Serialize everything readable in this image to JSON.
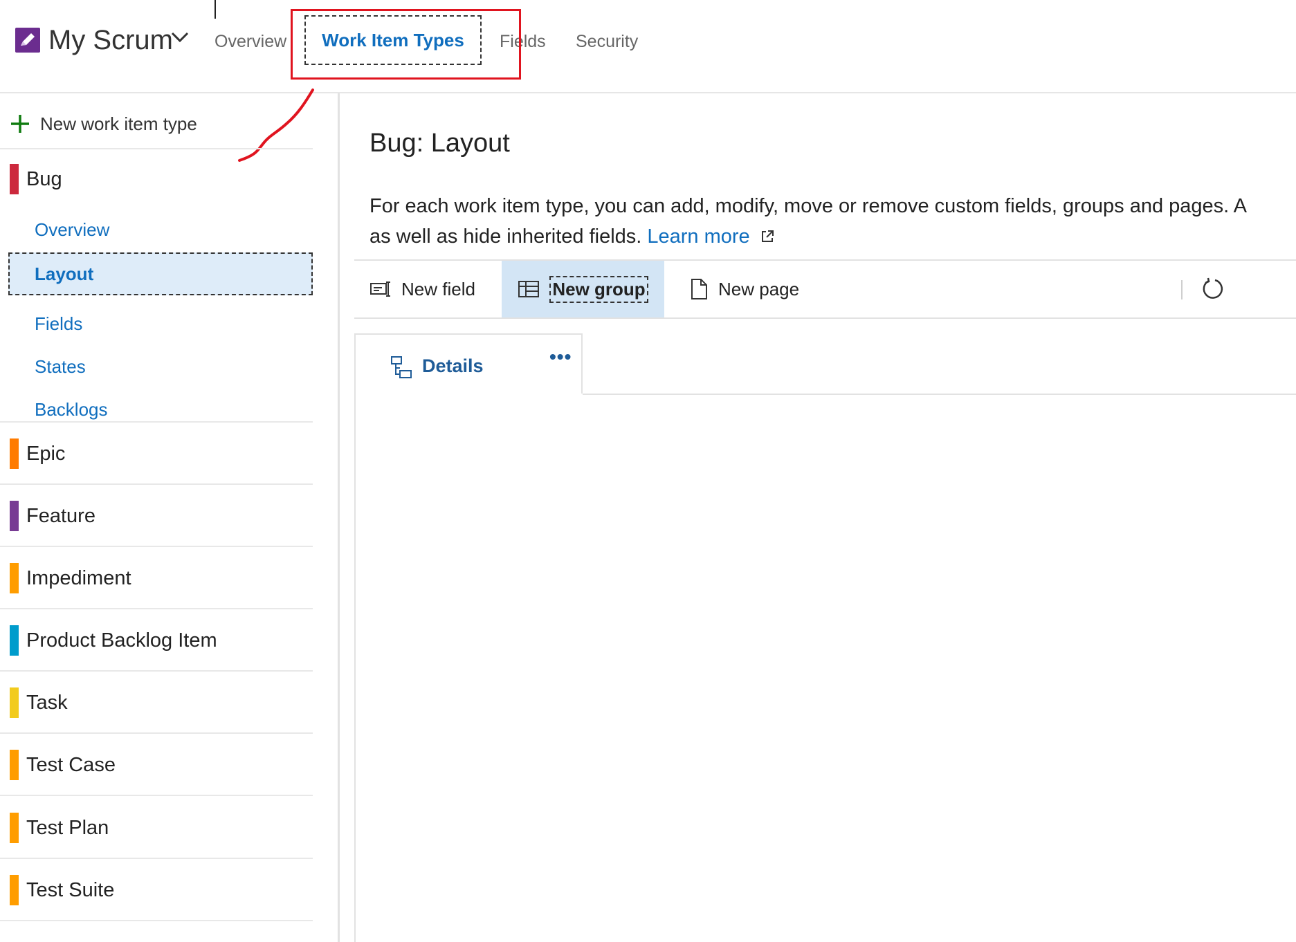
{
  "header": {
    "app_name": "My Scrum",
    "tabs": [
      "Overview",
      "Work Item Types",
      "Fields",
      "Security"
    ],
    "active_tab": "Work Item Types"
  },
  "sidebar": {
    "new_button": "New work item type",
    "selected_type": {
      "name": "Bug",
      "color": "#cc293d"
    },
    "subnav": [
      "Overview",
      "Layout",
      "Fields",
      "States",
      "Backlogs"
    ],
    "active_subnav": "Layout",
    "types": [
      {
        "name": "Epic",
        "color": "#ff7b00"
      },
      {
        "name": "Feature",
        "color": "#773b93"
      },
      {
        "name": "Impediment",
        "color": "#ff9d00"
      },
      {
        "name": "Product Backlog Item",
        "color": "#009ccc"
      },
      {
        "name": "Task",
        "color": "#f2cb1d"
      },
      {
        "name": "Test Case",
        "color": "#ff9d00"
      },
      {
        "name": "Test Plan",
        "color": "#ff9d00"
      },
      {
        "name": "Test Suite",
        "color": "#ff9d00"
      }
    ]
  },
  "main": {
    "title": "Bug: Layout",
    "description_line1": "For each work item type, you can add, modify, move or remove custom fields, groups and pages. A",
    "description_line2": "as well as hide inherited fields.",
    "learn_more": "Learn more",
    "toolbar": {
      "new_field": "New field",
      "new_group": "New group",
      "new_page": "New page"
    },
    "page_tab": "Details",
    "page_tab_more": "•••"
  },
  "colors": {
    "accent": "#106ebe",
    "annotation": "#e0141f",
    "selected_bg": "#deecf9",
    "logo": "#6b2d8f"
  }
}
